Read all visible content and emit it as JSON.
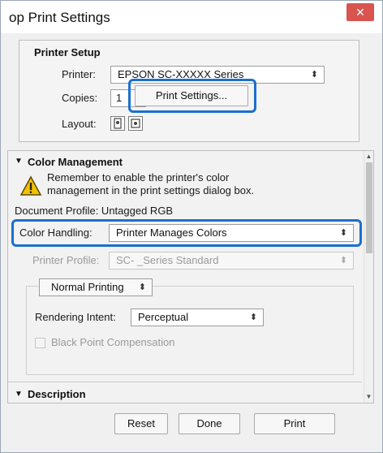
{
  "window": {
    "title": "op Print Settings",
    "close_glyph": "✕"
  },
  "printer_setup": {
    "title": "Printer Setup",
    "printer_label": "Printer:",
    "printer_value": "EPSON SC-XXXXX Series",
    "copies_label": "Copies:",
    "copies_value": "1",
    "print_settings_button": "Print Settings...",
    "layout_label": "Layout:"
  },
  "color_management": {
    "title": "Color Management",
    "expand_glyph": "▼",
    "warning_text": [
      "Remember to enable the printer's color",
      "management in the print settings dialog box."
    ],
    "document_profile": "Document Profile: Untagged RGB",
    "color_handling_label": "Color Handling:",
    "color_handling_value": "Printer Manages Colors",
    "printer_profile_label": "Printer Profile:",
    "printer_profile_value": "SC-          _Series Standard",
    "printing_mode_value": "Normal Printing",
    "rendering_intent_label": "Rendering Intent:",
    "rendering_intent_value": "Perceptual",
    "black_point_label": "Black Point Compensation"
  },
  "description": {
    "title": "Description",
    "expand_glyph": "▼"
  },
  "buttons": {
    "reset": "Reset",
    "done": "Done",
    "print": "Print"
  },
  "colors": {
    "highlight": "#1b6fd1",
    "close": "#d9534f",
    "warning": "#f2c200"
  }
}
